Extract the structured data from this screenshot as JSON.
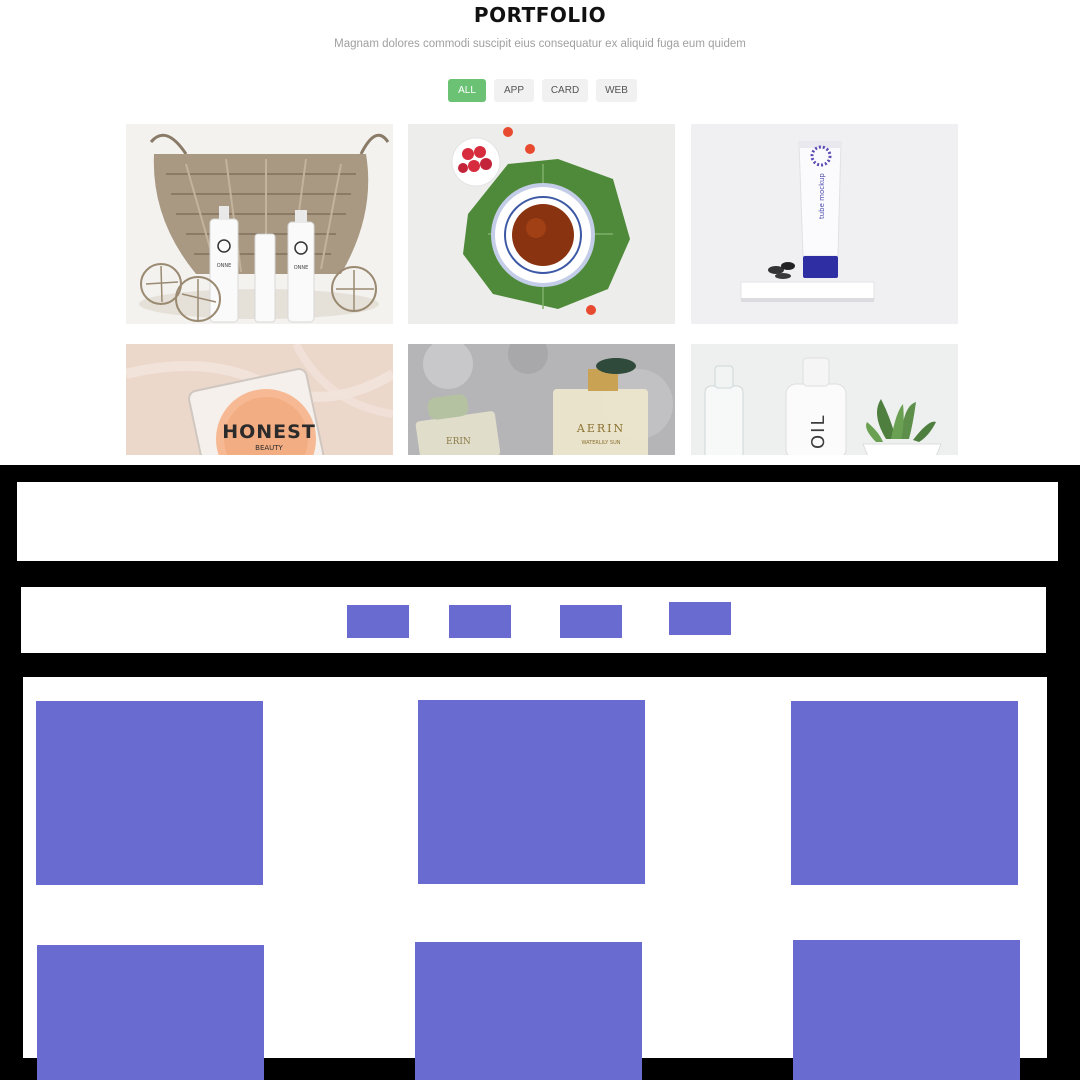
{
  "portfolio": {
    "title": "PORTFOLIO",
    "subtitle": "Magnam dolores commodi suscipit eius consequatur ex aliquid fuga eum quidem",
    "filters": [
      {
        "label": "ALL",
        "active": true
      },
      {
        "label": "APP",
        "active": false
      },
      {
        "label": "CARD",
        "active": false
      },
      {
        "label": "WEB",
        "active": false
      }
    ],
    "accent_color": "#6bc274",
    "items": [
      {
        "name": "basket-with-bottles",
        "brand_text": "ONNE"
      },
      {
        "name": "tea-cup-with-raspberries"
      },
      {
        "name": "tube-mockup",
        "product_text": "tube mockup"
      },
      {
        "name": "honest-beauty-compact",
        "brand_text": "HONEST",
        "sub_text": "BEAUTY"
      },
      {
        "name": "aerin-perfume-bottles",
        "brand_text": "AERIN",
        "product_text": "WATERLILY SUN",
        "side_text": "ERIN"
      },
      {
        "name": "oil-bottle-and-succulent",
        "product_text": "OIL"
      }
    ]
  },
  "wireframe": {
    "block_color": "#6a6bd1",
    "background_color": "#000000"
  }
}
